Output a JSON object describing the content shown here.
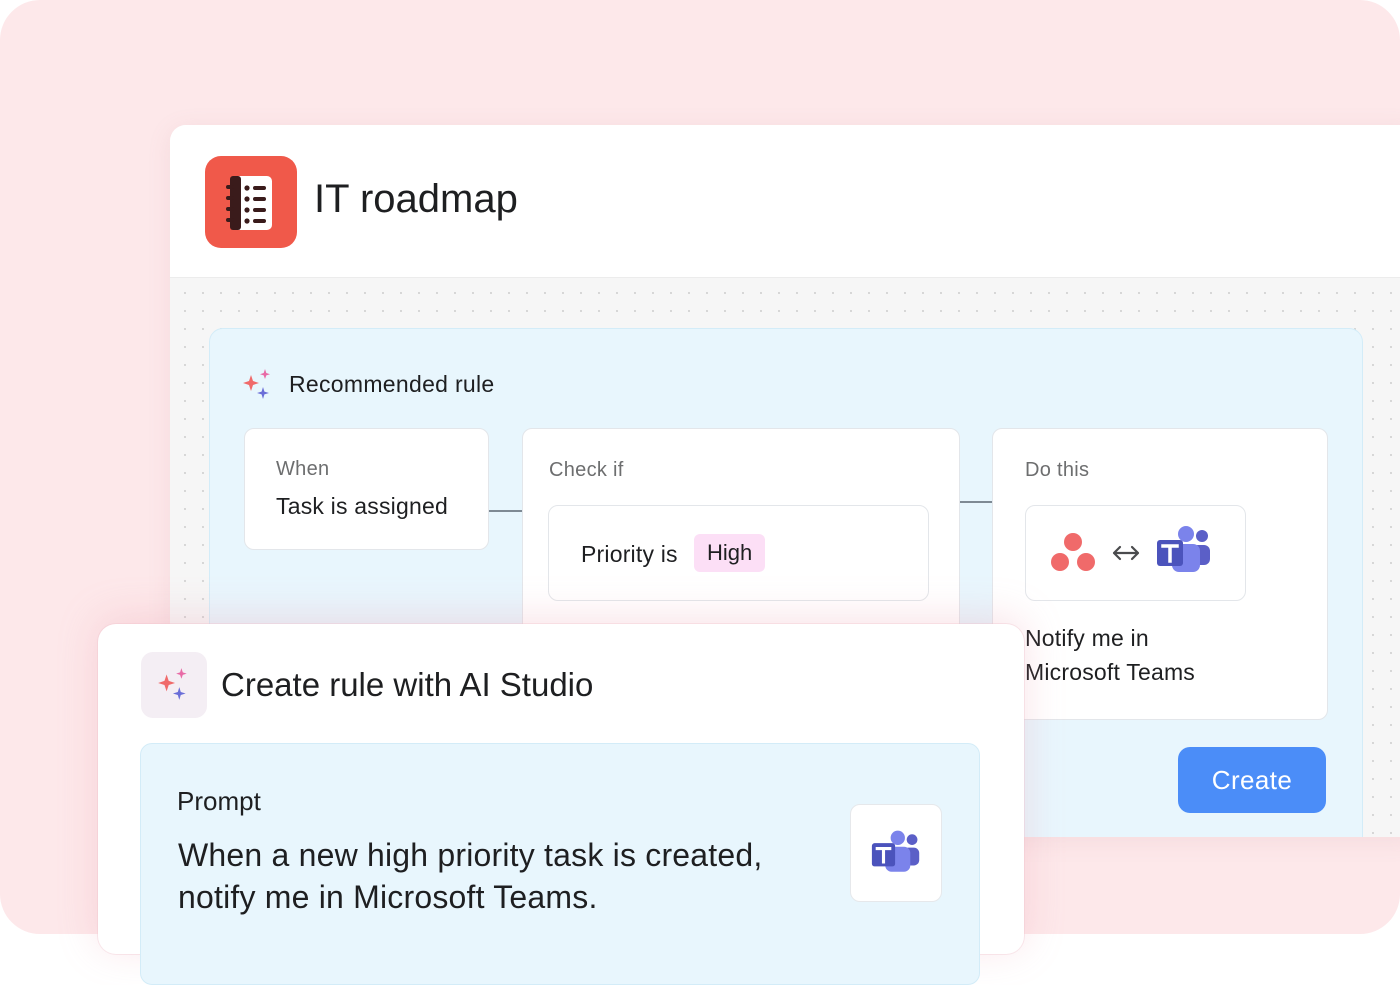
{
  "window": {
    "title": "IT roadmap",
    "app_icon": "notebook-list-icon"
  },
  "rule": {
    "heading": "Recommended rule",
    "trigger": {
      "label": "When",
      "value": "Task is assigned"
    },
    "condition": {
      "label": "Check if",
      "field_text": "Priority is",
      "tag": "High"
    },
    "action": {
      "label": "Do this",
      "icons": [
        "asana-icon",
        "swap-arrows-icon",
        "microsoft-teams-icon"
      ],
      "description_line1": "Notify me in",
      "description_line2": "Microsoft Teams"
    },
    "create_label": "Create"
  },
  "ai_studio": {
    "title": "Create rule with AI Studio",
    "prompt_label": "Prompt",
    "prompt_line1": "When a new high priority task is created,",
    "prompt_line2": "notify me in Microsoft Teams.",
    "attachment_icon": "microsoft-teams-icon"
  },
  "colors": {
    "page_background": "#fde8ea",
    "app_icon": "#f0594a",
    "panel": "#e8f6fd",
    "tag": "#fcdff6",
    "primary_button": "#4b8df8",
    "asana": "#f06a6a",
    "teams": "#5b5fc7"
  }
}
